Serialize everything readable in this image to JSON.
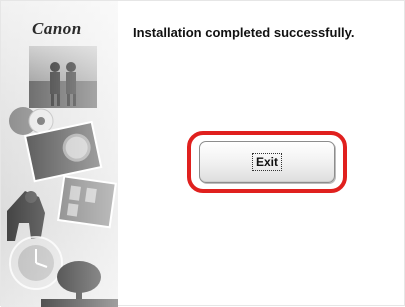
{
  "window": {
    "brand_logo": "Canon",
    "message": "Installation completed successfully.",
    "exit_label": "Exit"
  },
  "colors": {
    "highlight_outline": "#e0201e",
    "side_panel": "#e4e4e4",
    "background": "#ffffff"
  },
  "icons": {
    "side_art": "photo-collage-graphic"
  }
}
